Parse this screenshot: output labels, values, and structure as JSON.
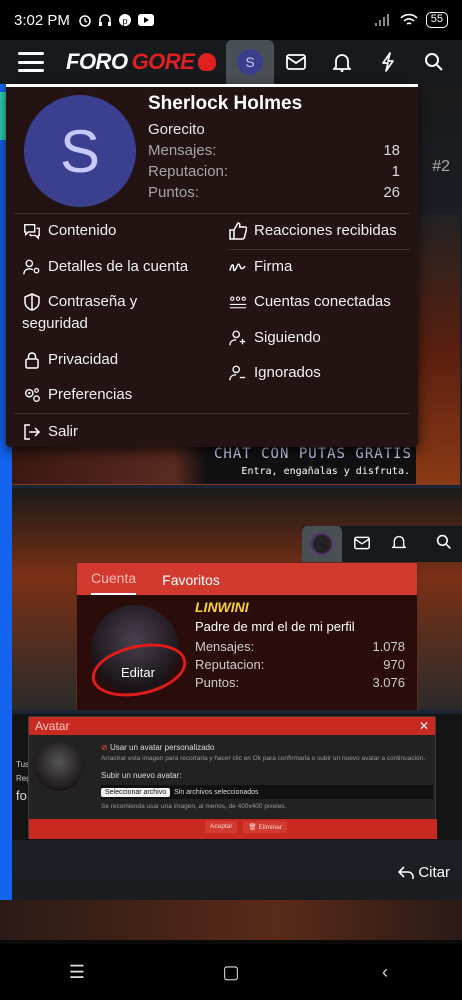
{
  "statusbar": {
    "time": "3:02 PM",
    "battery": "55"
  },
  "header": {
    "logo_part1": "FORO",
    "logo_part2": "GORE",
    "avatar_letter": "S"
  },
  "background": {
    "post_number": "#2",
    "banner_title": "CHAT CON PUTAS GRATIS",
    "banner_subtitle": "Entra, engañalas y disfruta.",
    "citar": "Citar"
  },
  "dropdown": {
    "avatar_letter": "S",
    "username": "Sherlock Holmes",
    "user_title": "Gorecito",
    "stats": [
      {
        "label": "Mensajes:",
        "value": "18"
      },
      {
        "label": "Reputacion:",
        "value": "1"
      },
      {
        "label": "Puntos:",
        "value": "26"
      }
    ],
    "left_menu": [
      {
        "label": "Contenido",
        "icon": "comments-icon"
      },
      {
        "label": "Detalles de la cuenta",
        "icon": "user-cog-icon"
      },
      {
        "label": "Contraseña y seguridad",
        "icon": "shield-icon"
      },
      {
        "label": "Privacidad",
        "icon": "lock-icon"
      },
      {
        "label": "Preferencias",
        "icon": "cogs-icon"
      }
    ],
    "right_menu": [
      {
        "label": "Reacciones recibidas",
        "icon": "thumbs-up-icon"
      },
      {
        "label": "Firma",
        "icon": "signature-icon"
      },
      {
        "label": "Cuentas conectadas",
        "icon": "connected-accounts-icon"
      },
      {
        "label": "Siguiendo",
        "icon": "user-plus-icon"
      },
      {
        "label": "Ignorados",
        "icon": "user-minus-icon"
      }
    ],
    "logout": "Salir"
  },
  "shot1": {
    "tabs": [
      "Cuenta",
      "Favoritos"
    ],
    "username": "LINWINI",
    "user_title": "Padre de mrd el de mi perfil",
    "edit_label": "Editar",
    "stats": [
      {
        "label": "Mensajes:",
        "value": "1.078"
      },
      {
        "label": "Reputacion:",
        "value": "970"
      },
      {
        "label": "Puntos:",
        "value": "3.076"
      }
    ]
  },
  "shot2": {
    "modal_title": "Avatar",
    "option_label": "Usar un avatar personalizado",
    "option_help": "Arrastrar esta imagen para recortarla y hacer clic en Ok para confirmarla o subir un nuevo avatar a continuación.",
    "upload_label": "Subir un nuevo avatar:",
    "file_button": "Seleccionar archivo",
    "file_status": "Sin archivos seleccionados",
    "hint": "Se recomienda usar una imagen, al menos, de 400x400 pixeles.",
    "accept": "Aceptar",
    "delete": "Eliminar",
    "side_tus": "Tus",
    "side_reg": "Reg",
    "side_fo": "fo"
  }
}
